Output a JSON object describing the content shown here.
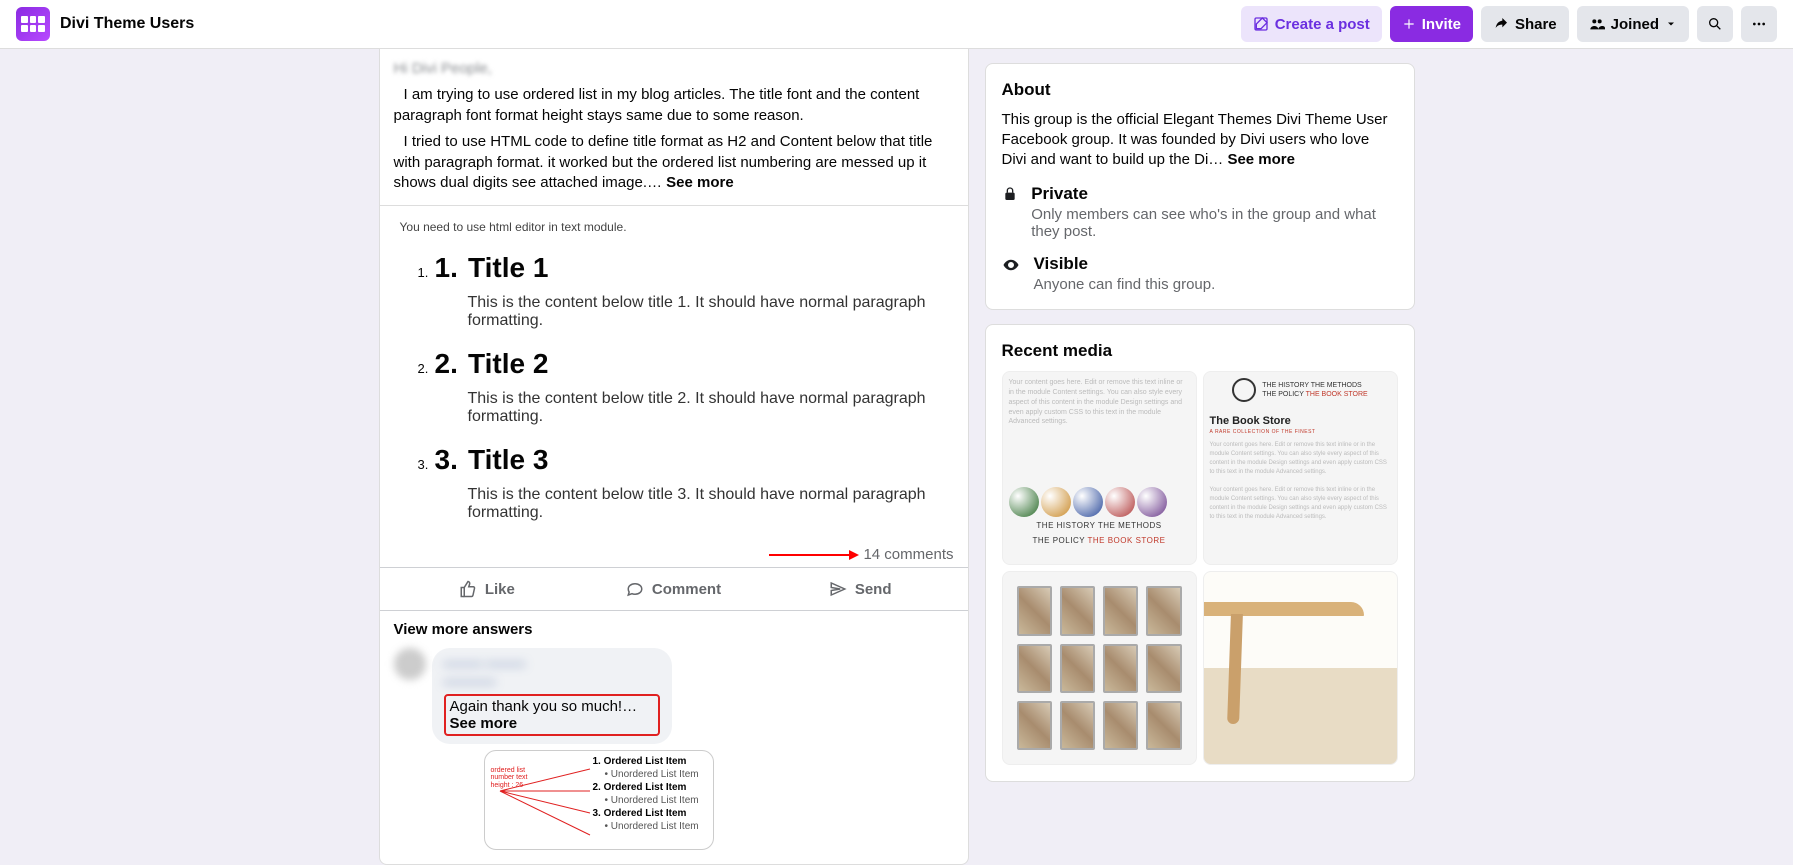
{
  "header": {
    "group_name": "Divi Theme Users",
    "create_post": "Create a post",
    "invite": "Invite",
    "share": "Share",
    "joined": "Joined"
  },
  "post": {
    "body_cutoff": "Hi Divi People,",
    "para1": "I am trying to use ordered list in my blog articles. The title font and the content paragraph font format height stays same due to some reason.",
    "para2": "I tried to use HTML code to define title format as H2 and Content below that title with paragraph format. it worked but the ordered list numbering are messed up it shows dual digits see attached image.… ",
    "see_more": "See more",
    "attachment_note": "You need to use html editor in text module.",
    "ol": [
      {
        "num_small": "1.",
        "num_big": "1.",
        "title": "Title 1",
        "content": "This is the content below title 1. It should have normal paragraph formatting."
      },
      {
        "num_small": "2.",
        "num_big": "2.",
        "title": "Title 2",
        "content": "This is the content below title 2. It should have normal paragraph formatting."
      },
      {
        "num_small": "3.",
        "num_big": "3.",
        "title": "Title 3",
        "content": "This is the content below title 3. It should have normal paragraph formatting."
      }
    ],
    "comments_count": "14 comments",
    "actions": {
      "like": "Like",
      "comment": "Comment",
      "send": "Send"
    },
    "view_more": "View more answers",
    "comment": {
      "author_blur": "———  ———",
      "author_blur2": "————",
      "text": "Again thank you so much!… ",
      "see_more": "See more",
      "att": {
        "label": "ordered list number text height : 26",
        "lines": [
          "1. Ordered List Item",
          "• Unordered List Item",
          "2. Ordered List Item",
          "• Unordered List Item",
          "3. Ordered List Item",
          "• Unordered List Item"
        ]
      }
    }
  },
  "about": {
    "heading": "About",
    "text": "This group is the official Elegant Themes Divi Theme User Facebook group. It was founded by Divi users who love Divi and want to build up the Di… ",
    "see_more": "See more",
    "private_title": "Private",
    "private_sub": "Only members can see who's in the group and what they post.",
    "visible_title": "Visible",
    "visible_sub": "Anyone can find this group."
  },
  "recent_media": {
    "heading": "Recent media",
    "thumb1_blurb": "Your content goes here. Edit or remove this text inline or in the module Content settings. You can also style every aspect of this content in the module Design settings and even apply custom CSS to this text in the module Advanced settings.",
    "thumb1_band": "THE HISTORY   THE METHODS",
    "thumb1_band2": "THE POLICY   THE BOOK STORE",
    "thumb2_hdr1": "THE HISTORY   THE METHODS",
    "thumb2_hdr2": "THE POLICY   THE BOOK STORE",
    "thumb2_title": "The Book Store"
  }
}
